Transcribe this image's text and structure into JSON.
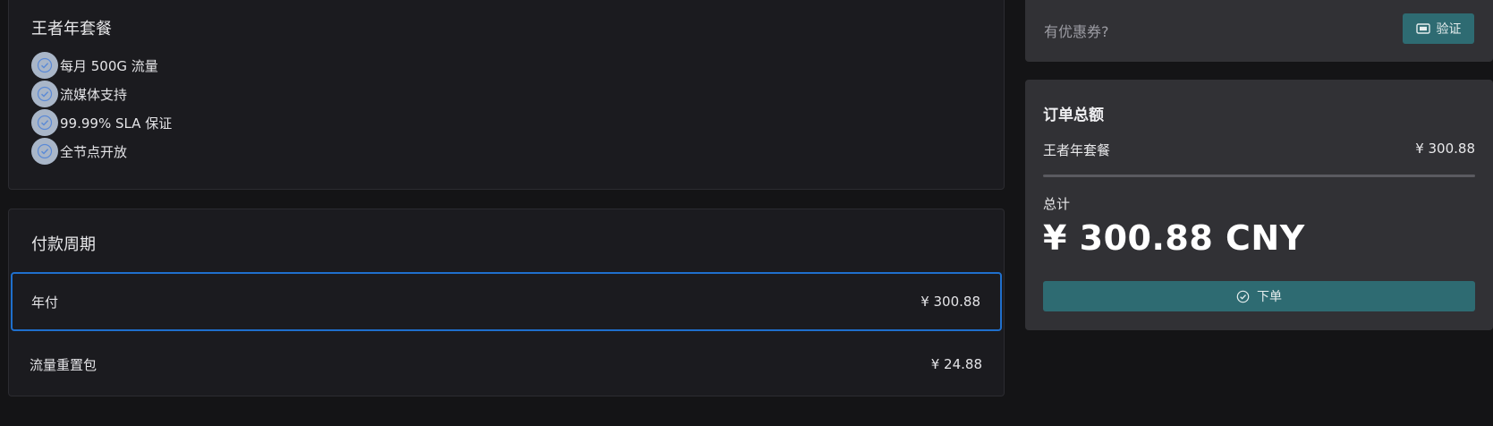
{
  "plan": {
    "title": "王者年套餐",
    "features": [
      {
        "label": "每月 500G 流量",
        "icon": "check-circle-icon"
      },
      {
        "label": "流媒体支持",
        "icon": "check-circle-icon"
      },
      {
        "label": "99.99% SLA 保证",
        "icon": "check-circle-icon"
      },
      {
        "label": "全节点开放",
        "icon": "check-circle-icon"
      }
    ]
  },
  "period": {
    "title": "付款周期",
    "options": [
      {
        "label": "年付",
        "price": "¥ 300.88",
        "selected": true
      },
      {
        "label": "流量重置包",
        "price": "¥ 24.88",
        "selected": false
      }
    ]
  },
  "coupon": {
    "placeholder": "有优惠券?",
    "verify_label": "验证",
    "verify_icon": "ticket-icon"
  },
  "summary": {
    "title": "订单总额",
    "line_item_label": "王者年套餐",
    "line_item_price": "¥ 300.88",
    "total_label": "总计",
    "total_value": "¥ 300.88 CNY",
    "order_label": "下单",
    "order_icon": "check-circle-icon"
  },
  "colors": {
    "page_bg": "#141416",
    "card_bg": "#1b1b1f",
    "panel_bg": "#313135",
    "accent_button": "#2e6b72",
    "selected_border": "#1f6fcc",
    "check_badge": "#a9b6c8"
  }
}
